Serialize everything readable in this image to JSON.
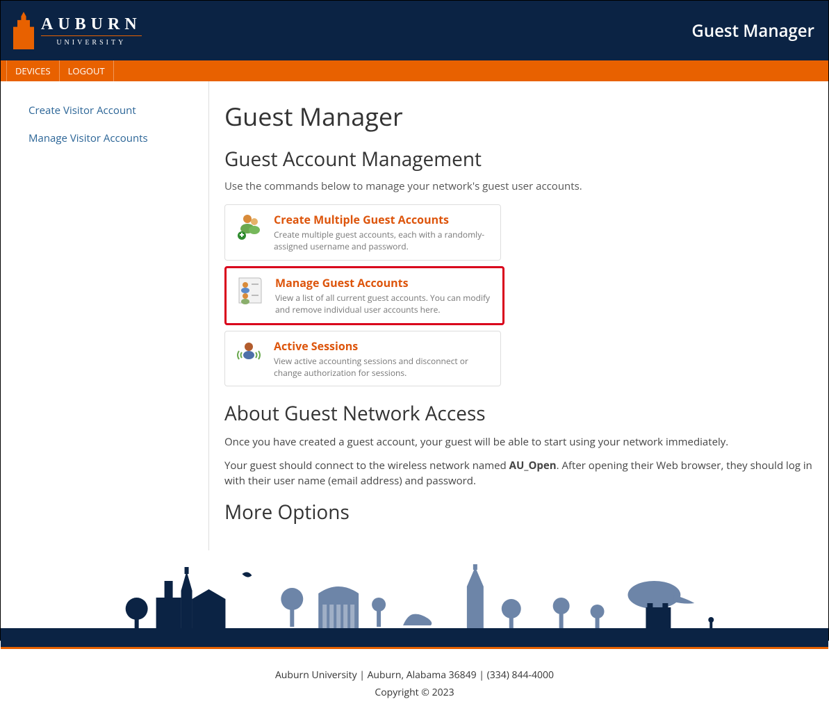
{
  "header": {
    "brand_main": "AUBURN",
    "brand_sub": "UNIVERSITY",
    "app_title": "Guest Manager"
  },
  "nav": {
    "items": [
      {
        "label": "DEVICES"
      },
      {
        "label": "LOGOUT"
      }
    ]
  },
  "sidebar": {
    "links": [
      {
        "label": "Create Visitor Account"
      },
      {
        "label": "Manage Visitor Accounts"
      }
    ]
  },
  "main": {
    "page_title": "Guest Manager",
    "section1_title": "Guest Account Management",
    "section1_lead": "Use the commands below to manage your network's guest user accounts.",
    "cards": [
      {
        "title": "Create Multiple Guest Accounts",
        "desc": "Create multiple guest accounts, each with a randomly-assigned username and password.",
        "icon": "users-plus-icon"
      },
      {
        "title": "Manage Guest Accounts",
        "desc": "View a list of all current guest accounts. You can modify and remove individual user accounts here.",
        "icon": "list-users-icon"
      },
      {
        "title": "Active Sessions",
        "desc": "View active accounting sessions and disconnect or change authorization for sessions.",
        "icon": "session-icon"
      }
    ],
    "section2_title": "About Guest Network Access",
    "section2_p1": "Once you have created a guest account, your guest will be able to start using your network immediately.",
    "section2_p2a": "Your guest should connect to the wireless network named ",
    "section2_p2_bold": "AU_Open",
    "section2_p2b": ". After opening their Web browser, they should log in with their user name (email address) and password.",
    "section3_title": "More Options"
  },
  "footer": {
    "line1": "Auburn University | Auburn, Alabama 36849 | (334) 844-4000",
    "copyright": "Copyright © 2023"
  }
}
